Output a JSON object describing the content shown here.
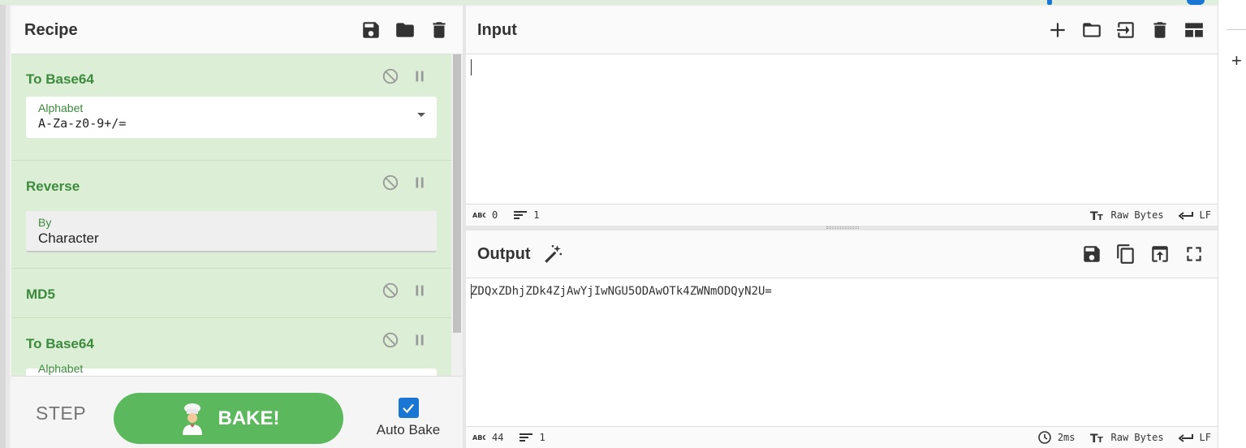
{
  "recipe": {
    "title": "Recipe",
    "operations": [
      {
        "title": "To Base64",
        "field_label": "Alphabet",
        "field_value": "A-Za-z0-9+/="
      },
      {
        "title": "Reverse",
        "field_label": "By",
        "field_value": "Character"
      },
      {
        "title": "MD5"
      },
      {
        "title": "To Base64",
        "field_label": "Alphabet"
      }
    ],
    "step_label": "STEP",
    "bake_label": "BAKE!",
    "auto_bake_label": "Auto Bake",
    "auto_bake_checked": true
  },
  "input": {
    "title": "Input",
    "char_count": "0",
    "line_count": "1",
    "encoding": "Raw Bytes",
    "eol": "LF"
  },
  "output": {
    "title": "Output",
    "text": "ZDQxZDhjZDk4ZjAwYjIwNGU5ODAwOTk4ZWNmODQyN2U=",
    "char_count": "44",
    "line_count": "1",
    "time": "2ms",
    "encoding": "Raw Bytes",
    "eol": "LF"
  },
  "colors": {
    "accent_green": "#5cb85c",
    "op_background": "#dcefd6",
    "op_title": "#3c8a3c",
    "checkbox_blue": "#1976d2"
  }
}
